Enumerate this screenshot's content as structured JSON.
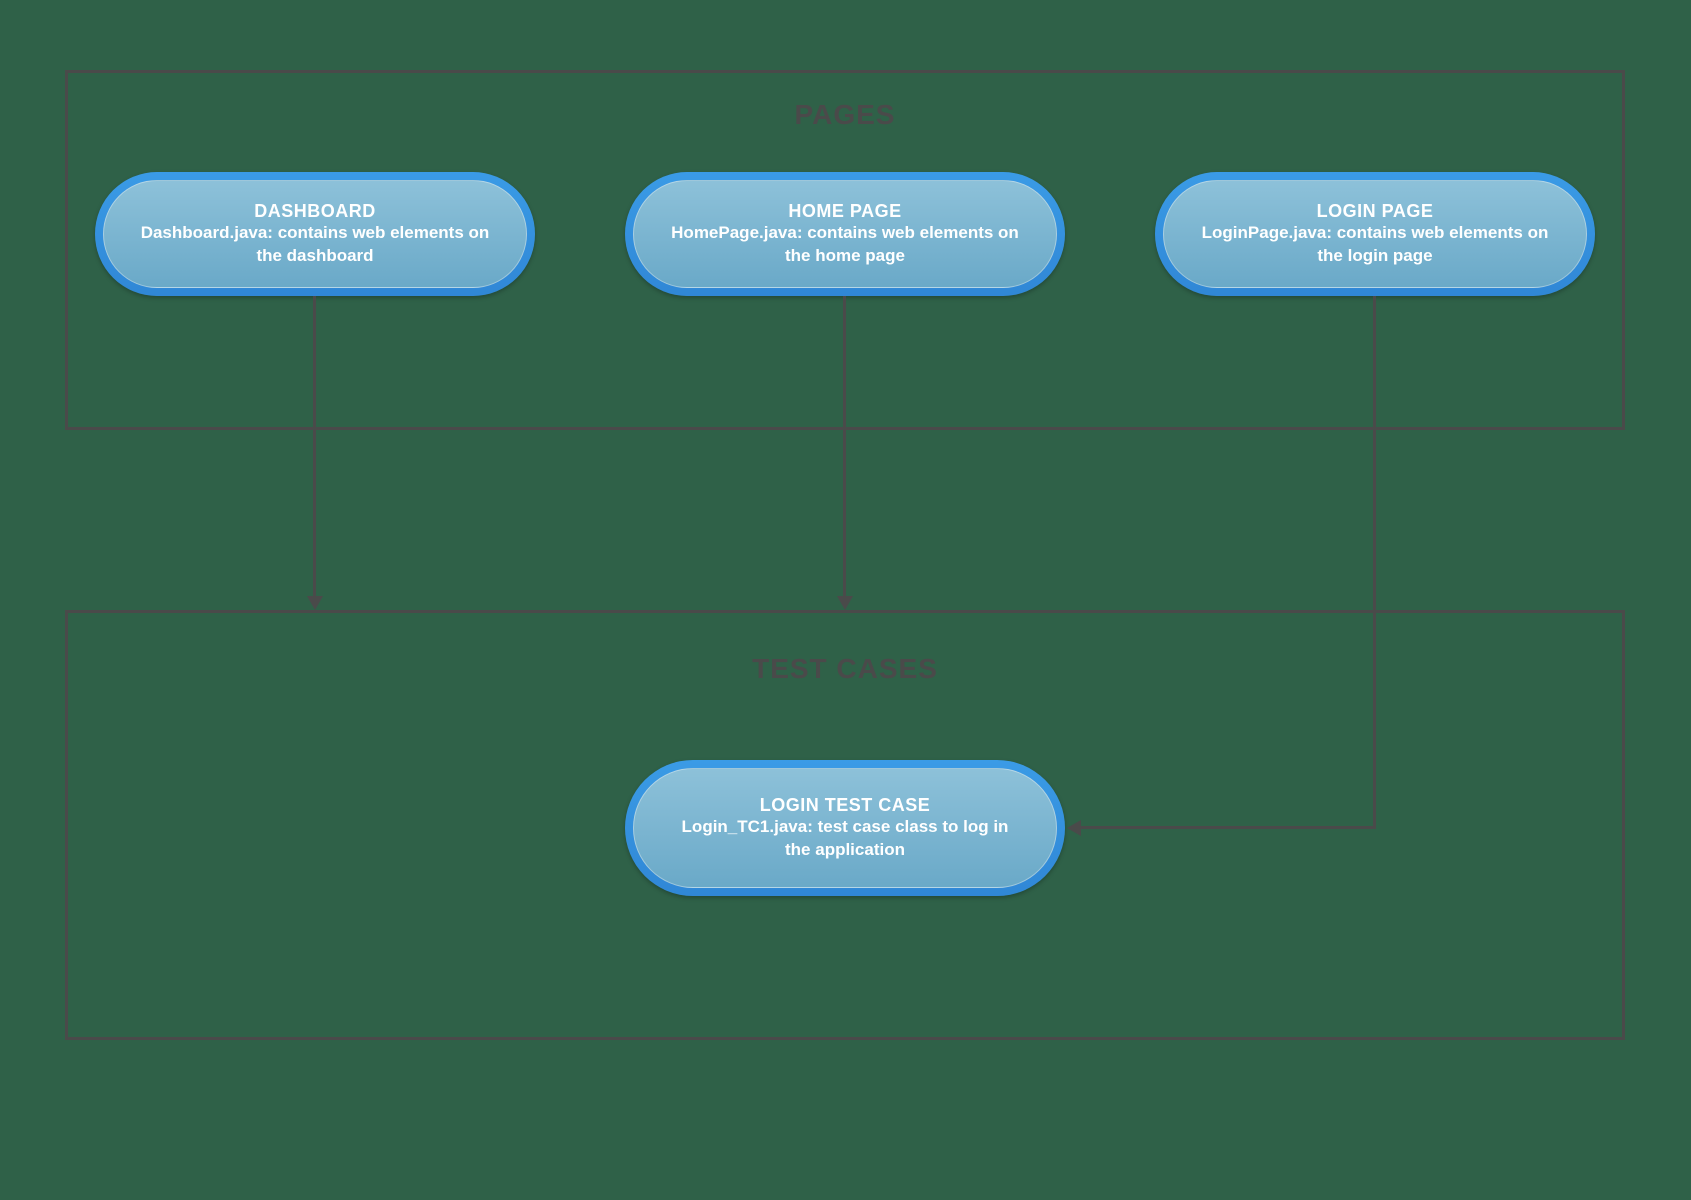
{
  "groups": {
    "pages": {
      "title": "PAGES"
    },
    "testcases": {
      "title": "TEST CASES"
    }
  },
  "nodes": {
    "dashboard": {
      "title": "DASHBOARD",
      "desc": "Dashboard.java: contains web elements on the dashboard"
    },
    "homepage": {
      "title": "HOME PAGE",
      "desc": "HomePage.java: contains web elements on the home page"
    },
    "loginpage": {
      "title": "LOGIN PAGE",
      "desc": "LoginPage.java: contains web elements on the login page"
    },
    "logintest": {
      "title": "LOGIN TEST CASE",
      "desc": "Login_TC1.java: test case class to log in the application"
    }
  }
}
